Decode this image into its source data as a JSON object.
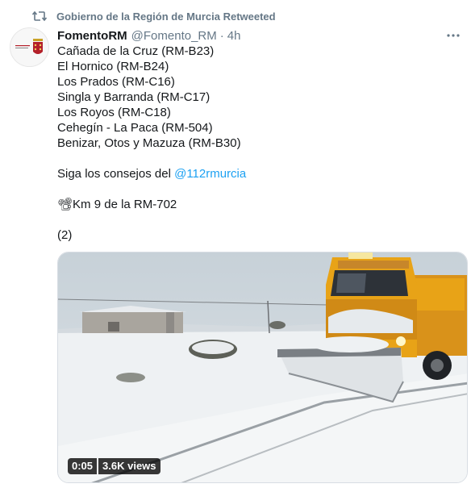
{
  "retweet": {
    "icon": "retweet-icon",
    "text": "Gobierno de la Región de Murcia Retweeted"
  },
  "author": {
    "avatar_icon": "murcia-crest-avatar",
    "display_name": "FomentoRM",
    "handle": "@Fomento_RM",
    "separator": "·",
    "time": "4h"
  },
  "tweet": {
    "lines": [
      "Cañada de la Cruz (RM-B23)",
      "El Hornico (RM-B24)",
      "Los Prados (RM-C16)",
      "Singla y Barranda (RM-C17)",
      "Los Royos (RM-C18)",
      "Cehegín - La Paca (RM-504)",
      "Benizar, Otos y Mazuza (RM-B30)"
    ],
    "advice_prefix": "Siga los consejos del ",
    "mention": "@112rmurcia",
    "camera_emoji": "📽",
    "location": "Km 9 de la RM-702",
    "count": "(2)"
  },
  "video": {
    "duration": "0:05",
    "views": "3.6K views",
    "thumbnail_subject": "snowplow-truck-snowy-road"
  },
  "colors": {
    "accent": "#1da1f2",
    "muted": "#657786",
    "text": "#14171a",
    "truck": "#e8a317"
  }
}
